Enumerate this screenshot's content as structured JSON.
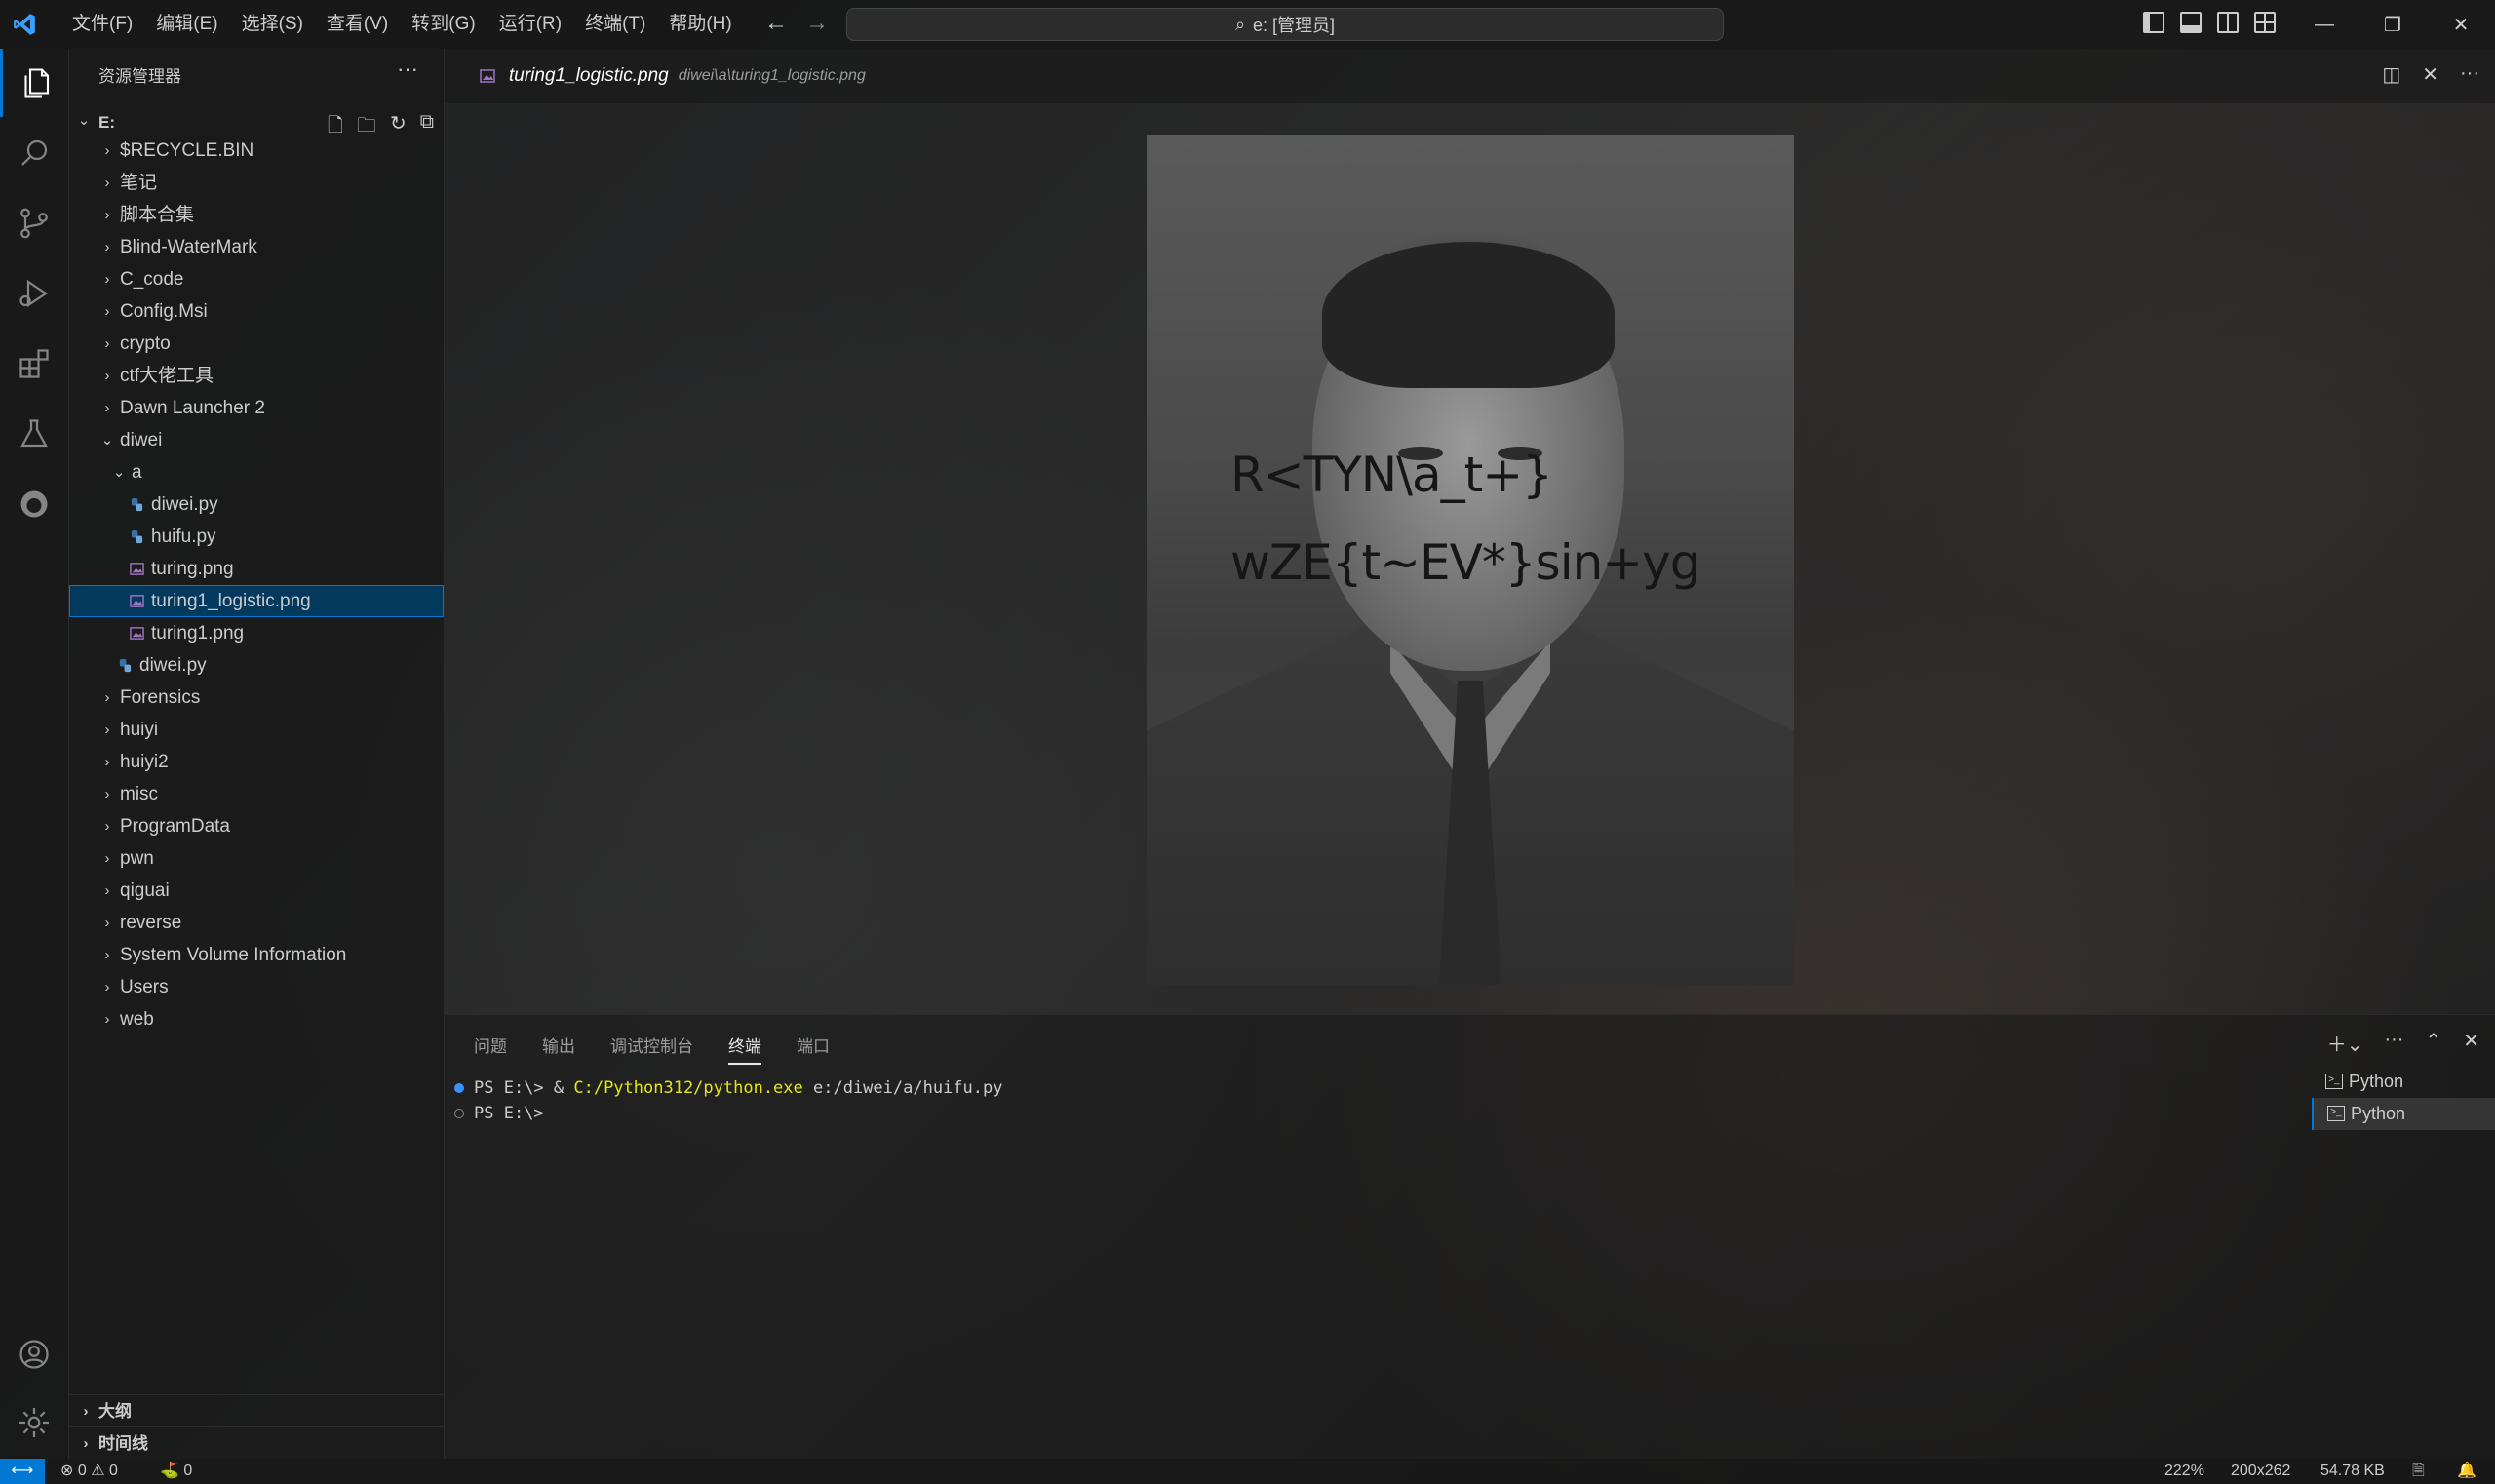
{
  "menu": [
    "文件(F)",
    "编辑(E)",
    "选择(S)",
    "查看(V)",
    "转到(G)",
    "运行(R)",
    "终端(T)",
    "帮助(H)"
  ],
  "command_center": {
    "text": "e: [管理员]"
  },
  "sidebar": {
    "title": "资源管理器",
    "root": "E:",
    "tree": [
      {
        "label": "$RECYCLE.BIN",
        "depth": 0,
        "type": "folder",
        "expanded": false
      },
      {
        "label": "笔记",
        "depth": 0,
        "type": "folder",
        "expanded": false
      },
      {
        "label": "脚本合集",
        "depth": 0,
        "type": "folder",
        "expanded": false
      },
      {
        "label": "Blind-WaterMark",
        "depth": 0,
        "type": "folder",
        "expanded": false
      },
      {
        "label": "C_code",
        "depth": 0,
        "type": "folder",
        "expanded": false
      },
      {
        "label": "Config.Msi",
        "depth": 0,
        "type": "folder",
        "expanded": false
      },
      {
        "label": "crypto",
        "depth": 0,
        "type": "folder",
        "expanded": false
      },
      {
        "label": "ctf大佬工具",
        "depth": 0,
        "type": "folder",
        "expanded": false
      },
      {
        "label": "Dawn Launcher 2",
        "depth": 0,
        "type": "folder",
        "expanded": false
      },
      {
        "label": "diwei",
        "depth": 0,
        "type": "folder",
        "expanded": true
      },
      {
        "label": "a",
        "depth": 1,
        "type": "folder",
        "expanded": true
      },
      {
        "label": "diwei.py",
        "depth": 2,
        "type": "py"
      },
      {
        "label": "huifu.py",
        "depth": 2,
        "type": "py"
      },
      {
        "label": "turing.png",
        "depth": 2,
        "type": "png"
      },
      {
        "label": "turing1_logistic.png",
        "depth": 2,
        "type": "png",
        "selected": true
      },
      {
        "label": "turing1.png",
        "depth": 2,
        "type": "png"
      },
      {
        "label": "diwei.py",
        "depth": 1,
        "type": "py"
      },
      {
        "label": "Forensics",
        "depth": 0,
        "type": "folder",
        "expanded": false
      },
      {
        "label": "huiyi",
        "depth": 0,
        "type": "folder",
        "expanded": false
      },
      {
        "label": "huiyi2",
        "depth": 0,
        "type": "folder",
        "expanded": false
      },
      {
        "label": "misc",
        "depth": 0,
        "type": "folder",
        "expanded": false
      },
      {
        "label": "ProgramData",
        "depth": 0,
        "type": "folder",
        "expanded": false
      },
      {
        "label": "pwn",
        "depth": 0,
        "type": "folder",
        "expanded": false
      },
      {
        "label": "qiguai",
        "depth": 0,
        "type": "folder",
        "expanded": false
      },
      {
        "label": "reverse",
        "depth": 0,
        "type": "folder",
        "expanded": false
      },
      {
        "label": "System Volume Information",
        "depth": 0,
        "type": "folder",
        "expanded": false
      },
      {
        "label": "Users",
        "depth": 0,
        "type": "folder",
        "expanded": false
      },
      {
        "label": "web",
        "depth": 0,
        "type": "folder",
        "expanded": false
      }
    ],
    "outline": "大纲",
    "timeline": "时间线"
  },
  "editor": {
    "tab_name": "turing1_logistic.png",
    "tab_path": "diwei\\a\\turing1_logistic.png",
    "image_text_line1": "R<TYN\\a_t+}",
    "image_text_line2": "wZE{t~EV*}sin+yg"
  },
  "panel": {
    "tabs": [
      "问题",
      "输出",
      "调试控制台",
      "终端",
      "端口"
    ],
    "active_tab": "终端",
    "terminal_lines": [
      {
        "prompt": "PS E:\\> & ",
        "exe": "C:/Python312/python.exe",
        "args": " e:/diwei/a/huifu.py",
        "dot": "filled"
      },
      {
        "prompt": "PS E:\\> ",
        "exe": "",
        "args": "",
        "dot": "empty"
      }
    ],
    "terminals": [
      "Python",
      "Python"
    ]
  },
  "statusbar": {
    "errors": "0",
    "warnings": "0",
    "ports": "0",
    "zoom": "222%",
    "dimensions": "200x262",
    "filesize": "54.78 KB"
  },
  "colors": {
    "accent": "#0078d4",
    "selection": "#04395e",
    "terminal_yellow": "#e5e510"
  }
}
